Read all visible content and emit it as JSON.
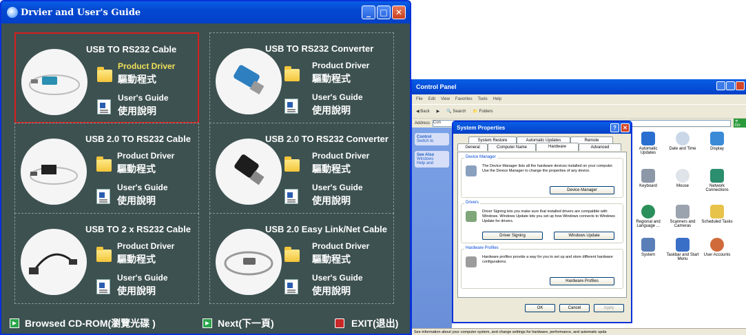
{
  "left_window": {
    "title": "Drvier and User's Guide",
    "items": [
      {
        "title": "USB  TO RS232 Cable",
        "driver": "Product Driver",
        "driver_zh": "驅動程式",
        "guide": "User's Guide",
        "guide_zh": "使用說明"
      },
      {
        "title": "USB  TO RS232 Converter",
        "driver": "Product Driver",
        "driver_zh": "驅動程式",
        "guide": "User's Guide",
        "guide_zh": "使用說明"
      },
      {
        "title": "USB 2.0 TO RS232 Cable",
        "driver": "Product Driver",
        "driver_zh": "驅動程式",
        "guide": "User's Guide",
        "guide_zh": "使用說明"
      },
      {
        "title": "USB 2.0 TO RS232  Converter",
        "driver": "Product Driver",
        "driver_zh": "驅動程式",
        "guide": "User's Guide",
        "guide_zh": "使用說明"
      },
      {
        "title": "USB TO 2 x RS232 Cable",
        "driver": "Product Driver",
        "driver_zh": "驅動程式",
        "guide": "User's Guide",
        "guide_zh": "使用說明"
      },
      {
        "title": "USB 2.0 Easy Link/Net Cable",
        "driver": "Product Driver",
        "driver_zh": "驅動程式",
        "guide": "User's Guide",
        "guide_zh": "使用說明"
      }
    ],
    "bottom": {
      "browse": "Browsed CD-ROM(瀏覽光碟 )",
      "next": "Next(下一頁)",
      "exit": "EXIT(退出)"
    },
    "colors": {
      "background": "#3d5150",
      "highlight_link": "#f0e05a",
      "selection_border": "#d81e1e"
    }
  },
  "right_window": {
    "title": "Control Panel",
    "menu": [
      "File",
      "Edit",
      "View",
      "Favorites",
      "Tools",
      "Help"
    ],
    "toolbar": {
      "back": "Back",
      "search": "Search",
      "folders": "Folders"
    },
    "address_label": "Address",
    "address_value": "Con",
    "go": "Go",
    "left_pane": {
      "control": "Control",
      "switch": "Switch to",
      "see_also": "See Also",
      "windows": "Windows",
      "help": "Help and"
    },
    "icons": [
      {
        "label": "Automatic Updates"
      },
      {
        "label": "Date and Time"
      },
      {
        "label": "Display"
      },
      {
        "label": "Keyboard"
      },
      {
        "label": "Mouse"
      },
      {
        "label": "Network Connections"
      },
      {
        "label": "Regional and Language ..."
      },
      {
        "label": "Scanners and Cameras"
      },
      {
        "label": "Scheduled Tasks"
      },
      {
        "label": "System"
      },
      {
        "label": "Taskbar and Start Menu"
      },
      {
        "label": "User Accounts"
      }
    ],
    "status": "See information about your computer system, and change settings for hardware, performance, and automatic upda",
    "dialog": {
      "title": "System Properties",
      "tabs_row1": [
        "System Restore",
        "Automatic Updates",
        "Remote"
      ],
      "tabs_row2": [
        "General",
        "Computer Name",
        "Hardware",
        "Advanced"
      ],
      "device_manager": {
        "label": "Device Manager",
        "text": "The Device Manager lists all the hardware devices installed on your computer. Use the Device Manager to change the properties of any device.",
        "button": "Device Manager"
      },
      "drivers": {
        "label": "Drivers",
        "text": "Driver Signing lets you make sure that installed drivers are compatible with Windows. Windows Update lets you set up how Windows connects to Windows Update for drivers.",
        "btn1": "Driver Signing",
        "btn2": "Windows Update"
      },
      "profiles": {
        "label": "Hardware Profiles",
        "text": "Hardware profiles provide a way for you to set up and store different hardware configurations.",
        "button": "Hardware Profiles"
      },
      "ok": "OK",
      "cancel": "Cancel",
      "apply": "Apply"
    }
  }
}
